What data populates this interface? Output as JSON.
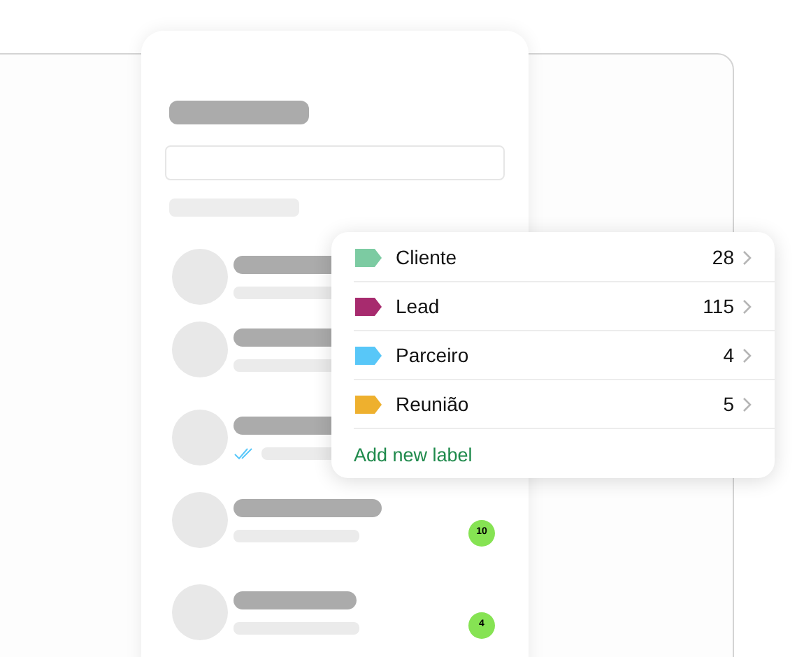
{
  "chats": [
    {
      "read_tick": false
    },
    {
      "read_tick": false
    },
    {
      "read_tick": true
    },
    {
      "read_tick": false,
      "badge": "10"
    },
    {
      "read_tick": false,
      "badge": "4"
    }
  ],
  "labels_menu": {
    "items": [
      {
        "name": "Cliente",
        "count": "28",
        "color": "#7ccba2"
      },
      {
        "name": "Lead",
        "count": "115",
        "color": "#a72b6e"
      },
      {
        "name": "Parceiro",
        "count": "4",
        "color": "#58c7f8"
      },
      {
        "name": "Reunião",
        "count": "5",
        "color": "#eeb02e"
      }
    ],
    "add_link": "Add new label"
  }
}
